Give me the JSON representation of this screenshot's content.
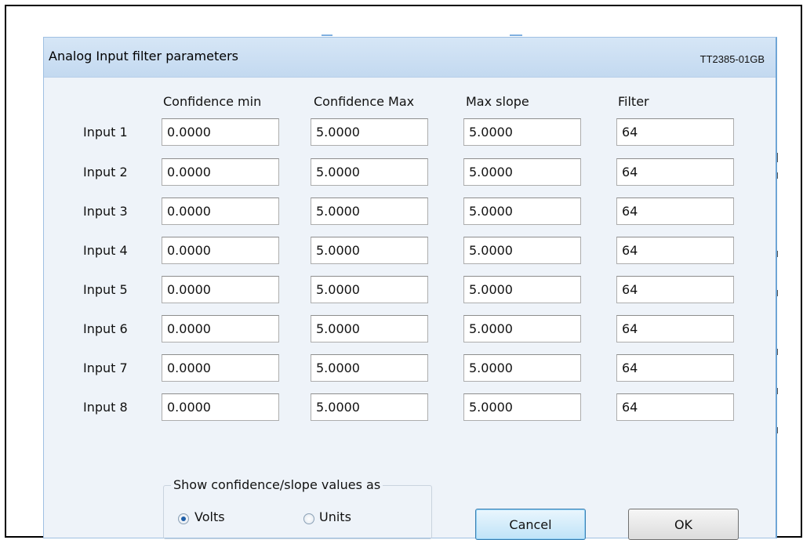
{
  "dialog": {
    "title": "Analog Input filter parameters",
    "doc_ref": "TT2385-01GB"
  },
  "columns": [
    "Confidence min",
    "Confidence Max",
    "Max slope",
    "Filter"
  ],
  "rows": [
    {
      "label": "Input 1",
      "values": [
        "0.0000",
        "5.0000",
        "5.0000",
        "64"
      ]
    },
    {
      "label": "Input 2",
      "values": [
        "0.0000",
        "5.0000",
        "5.0000",
        "64"
      ]
    },
    {
      "label": "Input 3",
      "values": [
        "0.0000",
        "5.0000",
        "5.0000",
        "64"
      ]
    },
    {
      "label": "Input 4",
      "values": [
        "0.0000",
        "5.0000",
        "5.0000",
        "64"
      ]
    },
    {
      "label": "Input 5",
      "values": [
        "0.0000",
        "5.0000",
        "5.0000",
        "64"
      ]
    },
    {
      "label": "Input 6",
      "values": [
        "0.0000",
        "5.0000",
        "5.0000",
        "64"
      ]
    },
    {
      "label": "Input 7",
      "values": [
        "0.0000",
        "5.0000",
        "5.0000",
        "64"
      ]
    },
    {
      "label": "Input 8",
      "values": [
        "0.0000",
        "5.0000",
        "5.0000",
        "64"
      ]
    }
  ],
  "display_mode": {
    "legend": "Show confidence/slope values as",
    "options": [
      {
        "label": "Volts",
        "checked": true
      },
      {
        "label": "Units",
        "checked": false
      }
    ]
  },
  "buttons": {
    "cancel": "Cancel",
    "ok": "OK"
  },
  "colors": {
    "titlebar": "#c8dcf1",
    "dialog_background": "#eef3f9",
    "default_button_border": "#3c7fb1",
    "radio_selected": "#1f5fa8"
  }
}
